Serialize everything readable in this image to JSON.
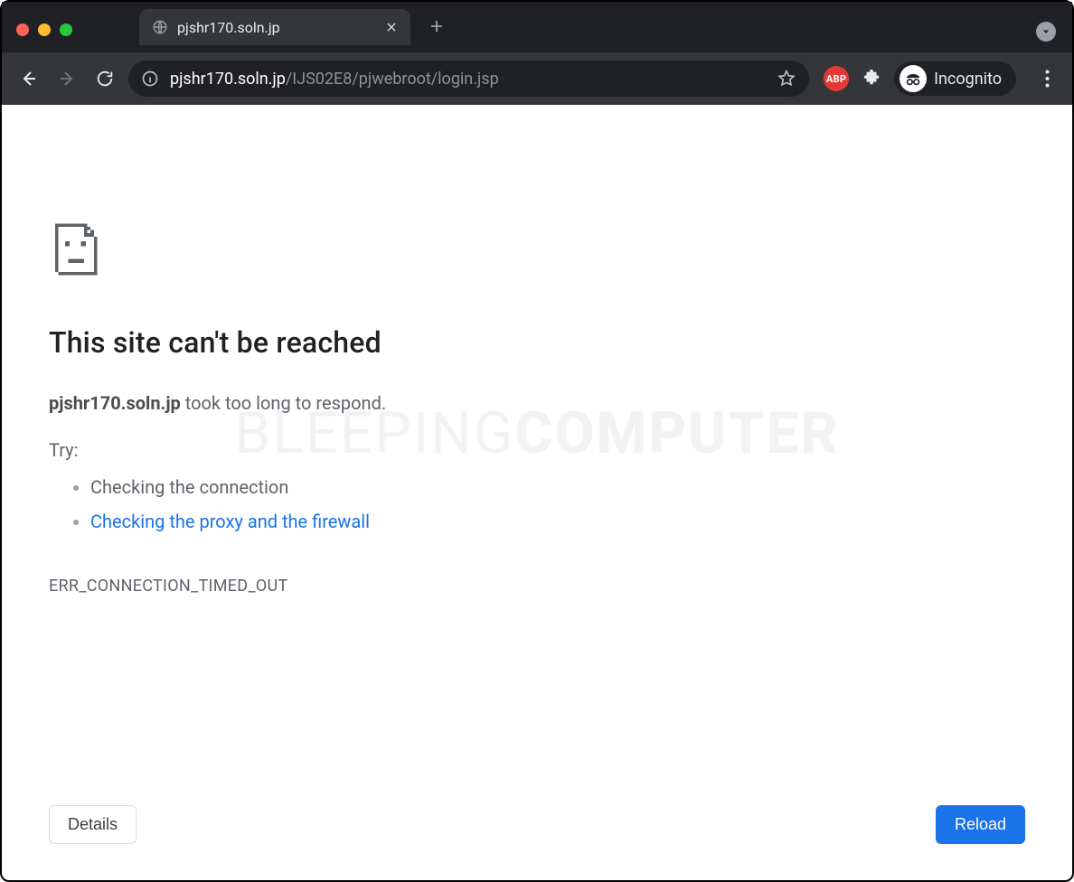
{
  "tab": {
    "title": "pjshr170.soln.jp"
  },
  "url": {
    "host": "pjshr170.soln.jp",
    "path": "/IJS02E8/pjwebroot/login.jsp"
  },
  "incognito": {
    "label": "Incognito"
  },
  "extension": {
    "abp_label": "ABP"
  },
  "error": {
    "heading": "This site can't be reached",
    "host": "pjshr170.soln.jp",
    "took_too_long": " took too long to respond.",
    "try_label": "Try:",
    "suggestions": {
      "check_connection": "Checking the connection",
      "check_proxy": "Checking the proxy and the firewall"
    },
    "code": "ERR_CONNECTION_TIMED_OUT"
  },
  "buttons": {
    "details": "Details",
    "reload": "Reload"
  },
  "watermark": {
    "left": "BLEEPING",
    "right": "COMPUTER"
  }
}
